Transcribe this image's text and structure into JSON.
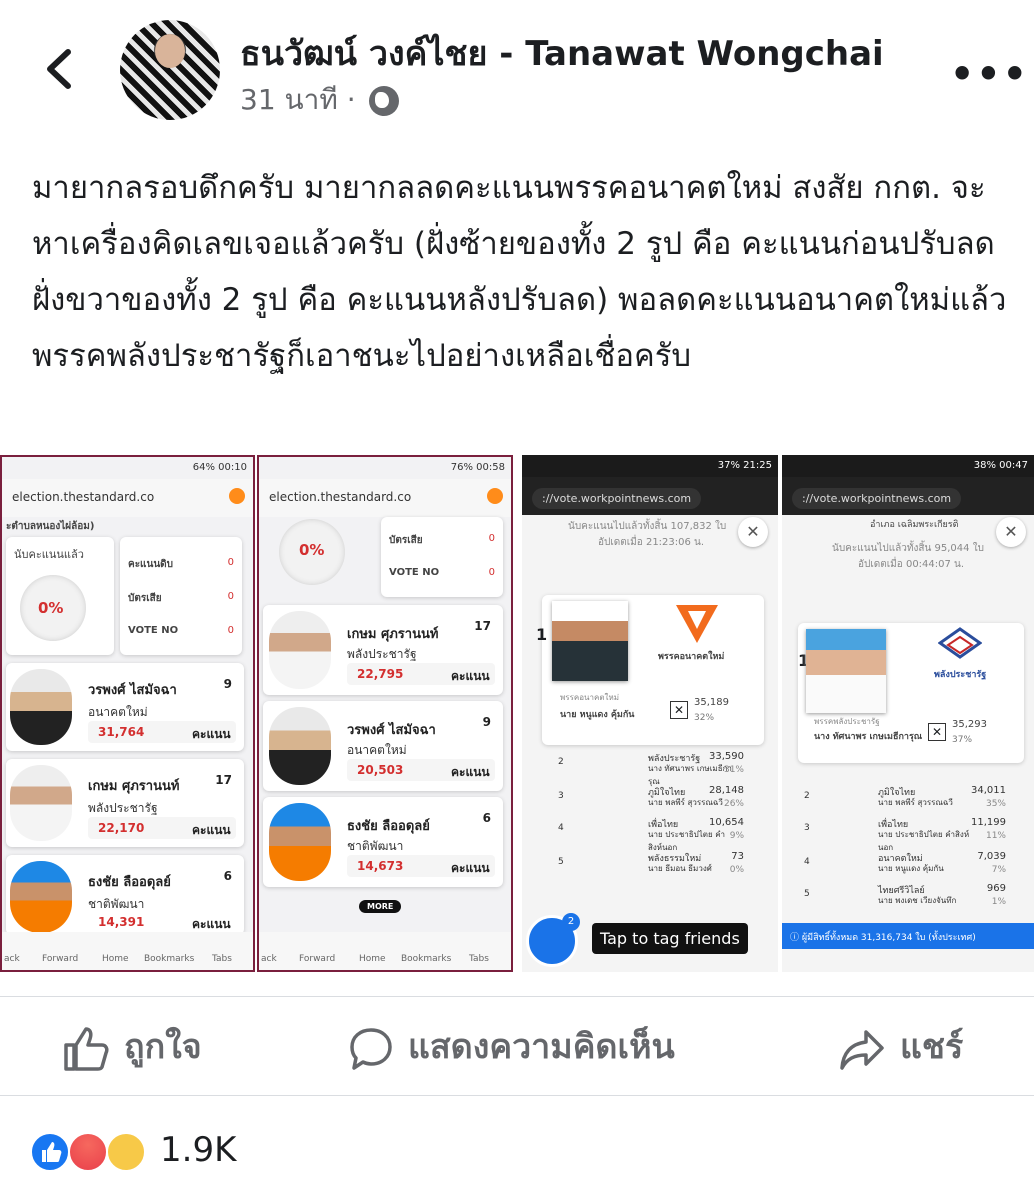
{
  "header": {
    "author": "ธนวัฒน์ วงค์ไชย - Tanawat Wongchai",
    "time": "31 นาที",
    "separator": "·",
    "privacy_icon": "globe-icon",
    "more": "•••"
  },
  "post": {
    "text": "มายากลรอบดึกครับ มายากลลดคะแนนพรรคอนาคตใหม่ สงสัย กกต. จะหาเครื่องคิดเลขเจอแล้วครับ (ฝั่งซ้ายของทั้ง 2 รูป คือ คะแนนก่อนปรับลด ฝั่งขวาของทั้ง 2 รูป คือ คะแนนหลังปรับลด) พอลดคะแนนอนาคตใหม่แล้ว พรรคพลังประชารัฐก็เอาชนะไปอย่างเหลือเชื่อครับ"
  },
  "shots": {
    "s1": {
      "status": "64% 00:10",
      "url": "election.thestandard.co",
      "area": "ะตำบลหนองไผ่ล้อม)",
      "counted_label": "นับคะแนนแล้ว",
      "percent": "0%",
      "stat1": "คะแนนดิบ",
      "stat2": "บัตรเสีย",
      "stat3": "VOTE NO",
      "zero": "0",
      "candidates": [
        {
          "name": "วรพงศ์ ไสมัจฉา",
          "party": "อนาคตใหม่",
          "votes": "31,764",
          "num": "9"
        },
        {
          "name": "เกษม ศุภรานนท์",
          "party": "พลังประชารัฐ",
          "votes": "22,170",
          "num": "17"
        },
        {
          "name": "ธงชัย ลืออดุลย์",
          "party": "ชาติพัฒนา",
          "votes": "14,391",
          "num": "6"
        }
      ],
      "unit": "คะแนน",
      "nav": [
        "ack",
        "Forward",
        "Home",
        "Bookmarks",
        "Tabs"
      ]
    },
    "s2": {
      "status": "76% 00:58",
      "url": "election.thestandard.co",
      "percent": "0%",
      "stat2": "บัตรเสีย",
      "stat3": "VOTE NO",
      "zero": "0",
      "candidates": [
        {
          "name": "เกษม ศุภรานนท์",
          "party": "พลังประชารัฐ",
          "votes": "22,795",
          "num": "17"
        },
        {
          "name": "วรพงศ์ ไสมัจฉา",
          "party": "อนาคตใหม่",
          "votes": "20,503",
          "num": "9"
        },
        {
          "name": "ธงชัย ลืออดุลย์",
          "party": "ชาติพัฒนา",
          "votes": "14,673",
          "num": "6"
        }
      ],
      "unit": "คะแนน",
      "more": "MORE",
      "nav": [
        "ack",
        "Forward",
        "Home",
        "Bookmarks",
        "Tabs"
      ]
    },
    "s3": {
      "status": "37% 21:25",
      "url": "://vote.workpointnews.com",
      "count1": "นับคะแนนไปแล้วทั้งสิ้น 107,832 ใบ",
      "count2": "อัปเดตเมื่อ 21:23:06 น.",
      "rank": "1",
      "party_logo": "พรรคอนาคตใหม่",
      "lead_party": "พรรคอนาคตใหม่",
      "lead_name": "นาย หนูแดง คุ้มกัน",
      "lead_votes": "35,189",
      "lead_pct": "32%",
      "rows": [
        {
          "rank": "2",
          "party": "พลังประชารัฐ",
          "name": "นาง ทัศนาพร เกษเมธีการุณ",
          "votes": "33,590",
          "pct": "31%"
        },
        {
          "rank": "3",
          "party": "ภูมิใจไทย",
          "name": "นาย พลพีร์ สุวรรณฉวี",
          "votes": "28,148",
          "pct": "26%"
        },
        {
          "rank": "4",
          "party": "เพื่อไทย",
          "name": "นาย ประชาธิปไตย คำสิงห์นอก",
          "votes": "10,654",
          "pct": "9%"
        },
        {
          "rank": "5",
          "party": "พลังธรรมใหม่",
          "name": "นาย ธีมอน ธีมวงศ์",
          "votes": "73",
          "pct": "0%"
        }
      ],
      "tag_count": "2",
      "tag_text": "Tap to tag friends"
    },
    "s4": {
      "status": "38% 00:47",
      "url": "://vote.workpointnews.com",
      "district": "อำเภอ เฉลิมพระเกียรติ",
      "count1": "นับคะแนนไปแล้วทั้งสิ้น 95,044 ใบ",
      "count2": "อัปเดตเมื่อ 00:44:07 น.",
      "rank": "1",
      "party_logo": "พลังประชารัฐ",
      "lead_party": "พรรคพลังประชารัฐ",
      "lead_name": "นาง ทัศนาพร เกษเมธีการุณ",
      "lead_votes": "35,293",
      "lead_pct": "37%",
      "rows": [
        {
          "rank": "2",
          "party": "ภูมิใจไทย",
          "name": "นาย พลพีร์ สุวรรณฉวี",
          "votes": "34,011",
          "pct": "35%"
        },
        {
          "rank": "3",
          "party": "เพื่อไทย",
          "name": "นาย ประชาธิปไตย คำสิงห์นอก",
          "votes": "11,199",
          "pct": "11%"
        },
        {
          "rank": "4",
          "party": "อนาคตใหม่",
          "name": "นาย หนูแดง คุ้มกัน",
          "votes": "7,039",
          "pct": "7%"
        },
        {
          "rank": "5",
          "party": "ไทยศรีวิไลย์",
          "name": "นาย พงเดช เวียงจันทึก",
          "votes": "969",
          "pct": "1%"
        }
      ],
      "footer": "ผู้มีสิทธิ์ทั้งหมด 31,316,734 ใบ (ทั้งประเทศ)"
    }
  },
  "actions": {
    "like": "ถูกใจ",
    "comment": "แสดงความคิดเห็น",
    "share": "แชร์"
  },
  "reactions": {
    "count": "1.9K",
    "types": [
      "like",
      "angry",
      "sad"
    ]
  },
  "colors": {
    "brand": "#1877f2",
    "text": "#1c1e21",
    "muted": "#65676b",
    "vote_red": "#d32f2f",
    "tag_blue": "#1a73e8"
  }
}
